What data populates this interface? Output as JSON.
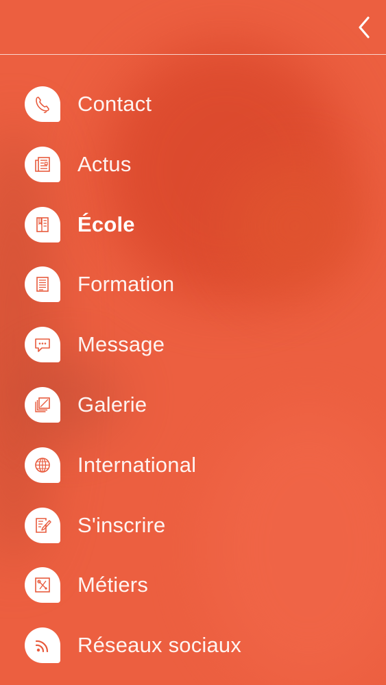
{
  "colors": {
    "background": "#ec5f40",
    "icon_background": "#ffffff",
    "icon_stroke": "#e85a3c",
    "text": "#ffffff"
  },
  "header": {
    "back_icon": "chevron-left-icon"
  },
  "menu": {
    "active_index": 2,
    "items": [
      {
        "label": "Contact",
        "icon": "phone-icon"
      },
      {
        "label": "Actus",
        "icon": "newspaper-icon"
      },
      {
        "label": "École",
        "icon": "book-icon"
      },
      {
        "label": "Formation",
        "icon": "document-icon"
      },
      {
        "label": "Message",
        "icon": "chat-bubble-icon"
      },
      {
        "label": "Galerie",
        "icon": "gallery-icon"
      },
      {
        "label": "International",
        "icon": "globe-icon"
      },
      {
        "label": "S'inscrire",
        "icon": "signup-pen-icon"
      },
      {
        "label": "Métiers",
        "icon": "tools-icon"
      },
      {
        "label": "Réseaux sociaux",
        "icon": "wifi-icon"
      }
    ]
  }
}
